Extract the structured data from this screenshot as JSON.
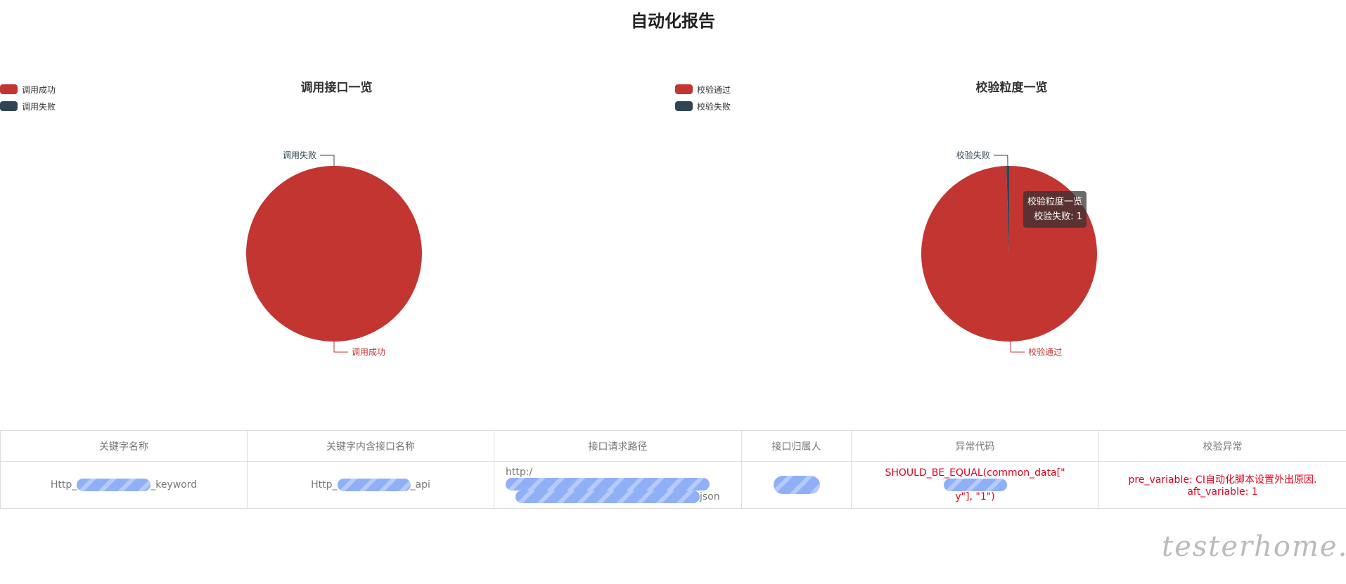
{
  "page": {
    "title": "自动化报告"
  },
  "chart_data": [
    {
      "type": "pie",
      "title": "调用接口一览",
      "legend_position": "top-left",
      "slices": [
        {
          "label": "调用成功",
          "value": 100,
          "color": "#c23531"
        },
        {
          "label": "调用失败",
          "value": 0,
          "color": "#2f4554"
        }
      ]
    },
    {
      "type": "pie",
      "title": "校验粒度一览",
      "legend_position": "top-left",
      "slices": [
        {
          "label": "校验通过",
          "value": 199,
          "color": "#c23531"
        },
        {
          "label": "校验失败",
          "value": 1,
          "color": "#2f4554"
        }
      ],
      "tooltip": {
        "title": "校验粒度一览",
        "text": "校验失败: 1"
      }
    }
  ],
  "table": {
    "headers": [
      "关键字名称",
      "关键字内含接口名称",
      "接口请求路径",
      "接口归属人",
      "异常代码",
      "校验异常"
    ],
    "row": {
      "keyword_prefix": "Http_",
      "keyword_suffix": "_keyword",
      "api_prefix": "Http_",
      "api_suffix": "_api",
      "path_prefix": "http:/",
      "path_suffix": "json",
      "error_code_line1": "SHOULD_BE_EQUAL(common_data[\"",
      "error_code_line2": "y\"], \"1\")",
      "verify_line1": "pre_variable: CI自动化脚本设置外出原因.",
      "verify_line2": "aft_variable: 1"
    }
  },
  "watermark": "testerhome.com"
}
